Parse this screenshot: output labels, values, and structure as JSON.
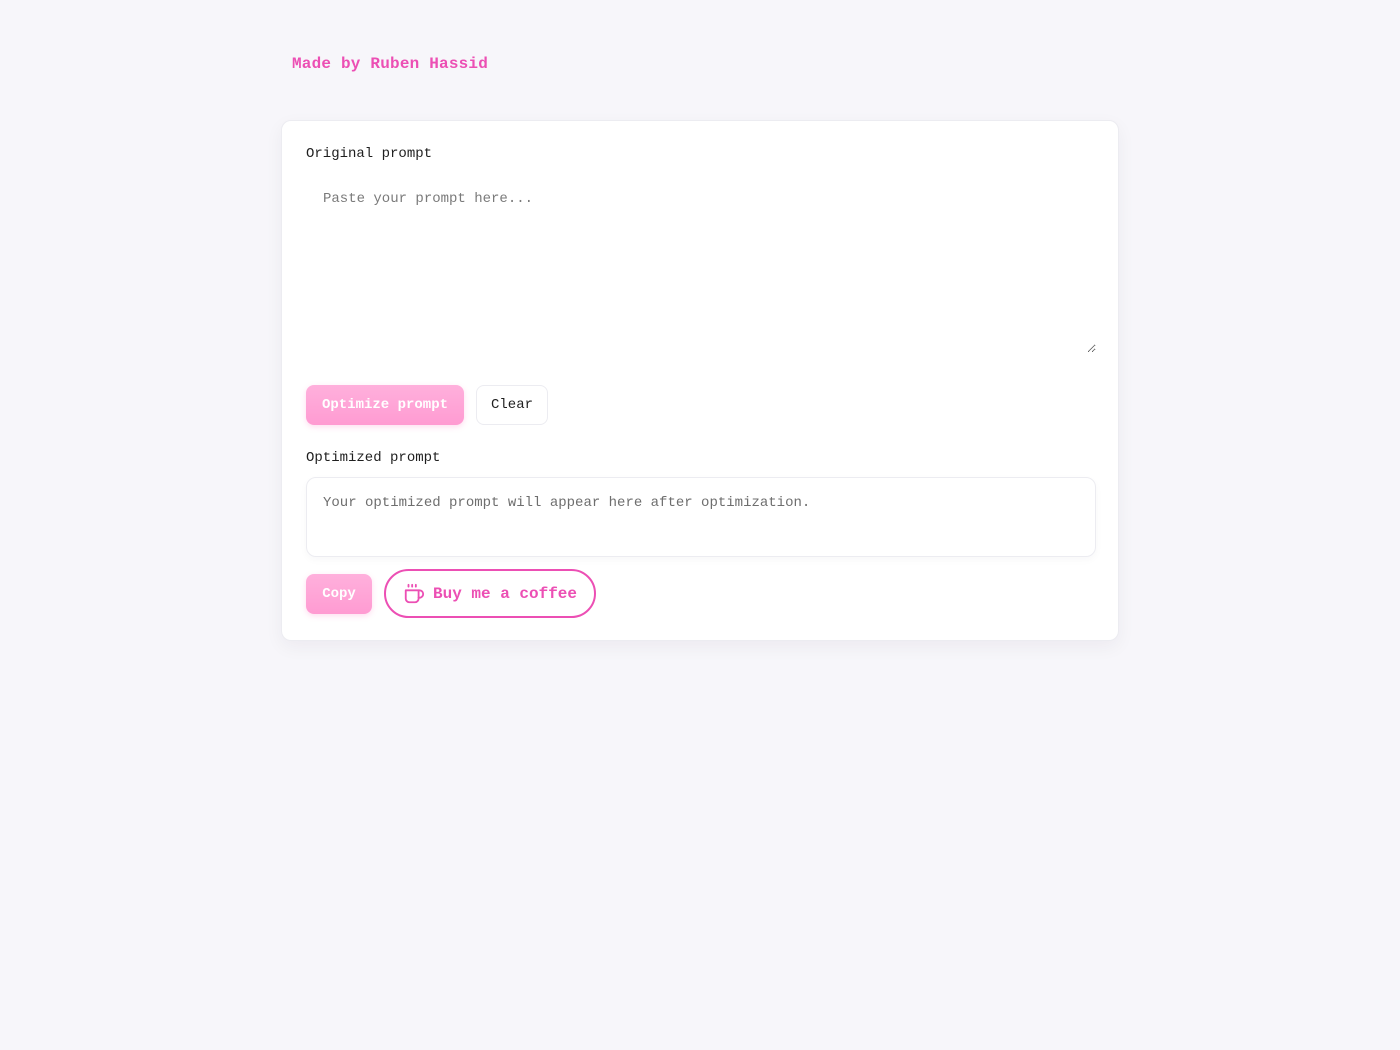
{
  "header": {
    "credit": "Made by Ruben Hassid"
  },
  "original": {
    "label": "Original prompt",
    "placeholder": "Paste your prompt here...",
    "value": ""
  },
  "actions": {
    "optimize_label": "Optimize prompt",
    "clear_label": "Clear"
  },
  "optimized": {
    "label": "Optimized prompt",
    "placeholder_text": "Your optimized prompt will appear here after optimization."
  },
  "bottom_actions": {
    "copy_label": "Copy",
    "coffee_label": "Buy me a coffee",
    "coffee_icon": "coffee-cup-icon"
  },
  "colors": {
    "accent": "#ec4fb4",
    "primary_button": "#ffa6d6",
    "background": "#f7f6fa",
    "card": "#ffffff"
  }
}
